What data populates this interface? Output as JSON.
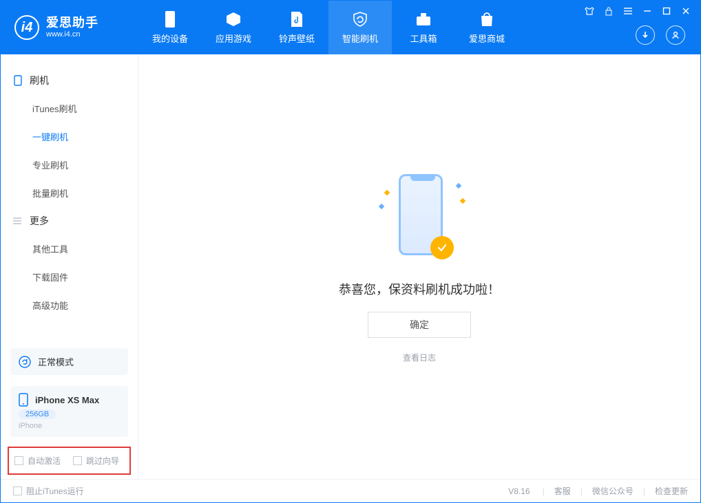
{
  "app": {
    "title": "爱思助手",
    "subtitle": "www.i4.cn"
  },
  "nav": {
    "tabs": [
      {
        "label": "我的设备"
      },
      {
        "label": "应用游戏"
      },
      {
        "label": "铃声壁纸"
      },
      {
        "label": "智能刷机"
      },
      {
        "label": "工具箱"
      },
      {
        "label": "爱思商城"
      }
    ],
    "active_index": 3
  },
  "sidebar": {
    "group_flash": {
      "title": "刷机",
      "items": [
        "iTunes刷机",
        "一键刷机",
        "专业刷机",
        "批量刷机"
      ],
      "active_index": 1
    },
    "group_more": {
      "title": "更多",
      "items": [
        "其他工具",
        "下载固件",
        "高级功能"
      ]
    },
    "mode_label": "正常模式",
    "device": {
      "name": "iPhone XS Max",
      "capacity": "256GB",
      "type": "iPhone"
    },
    "options": {
      "auto_activate": "自动激活",
      "skip_guide": "跳过向导"
    }
  },
  "main": {
    "success_message": "恭喜您，保资料刷机成功啦！",
    "confirm_button": "确定",
    "view_log": "查看日志"
  },
  "footer": {
    "block_itunes": "阻止iTunes运行",
    "version": "V8.16",
    "links": [
      "客服",
      "微信公众号",
      "检查更新"
    ]
  }
}
